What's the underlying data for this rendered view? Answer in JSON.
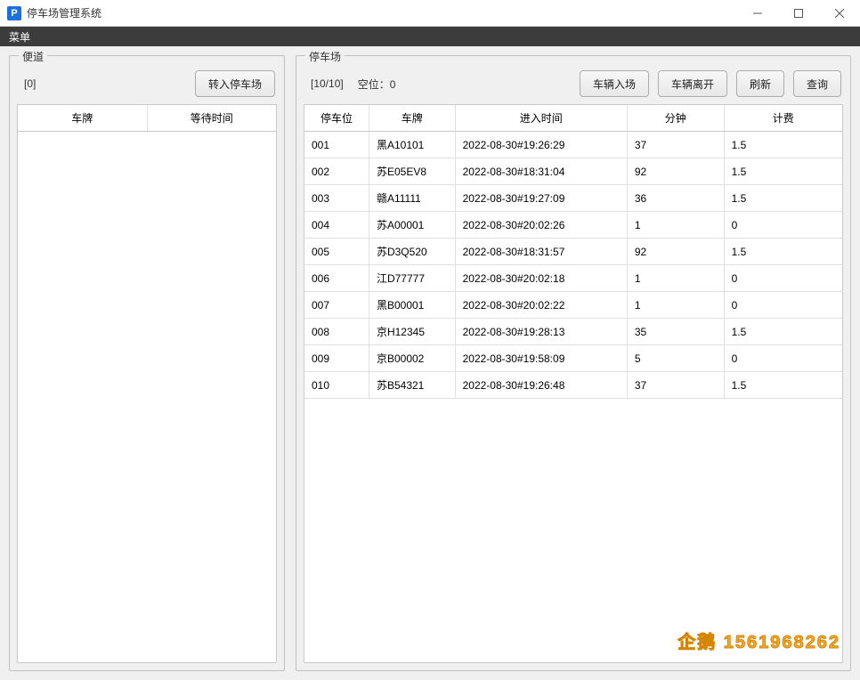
{
  "window": {
    "title": "停车场管理系统"
  },
  "menubar": {
    "menu": "菜单"
  },
  "lane": {
    "group_title": "便道",
    "count_label": "[0]",
    "enter_button": "转入停车场",
    "columns": {
      "plate": "车牌",
      "wait": "等待时间"
    },
    "rows": []
  },
  "lot": {
    "group_title": "停车场",
    "occupancy": "[10/10]",
    "vacancy_label": "空位：0",
    "buttons": {
      "vehicle_in": "车辆入场",
      "vehicle_out": "车辆离开",
      "refresh": "刷新",
      "query": "查询"
    },
    "columns": {
      "slot": "停车位",
      "plate": "车牌",
      "enter_time": "进入时间",
      "minutes": "分钟",
      "fee": "计费"
    },
    "rows": [
      {
        "slot": "001",
        "plate": "黑A10101",
        "enter_time": "2022-08-30#19:26:29",
        "minutes": "37",
        "fee": "1.5"
      },
      {
        "slot": "002",
        "plate": "苏E05EV8",
        "enter_time": "2022-08-30#18:31:04",
        "minutes": "92",
        "fee": "1.5"
      },
      {
        "slot": "003",
        "plate": "赣A11111",
        "enter_time": "2022-08-30#19:27:09",
        "minutes": "36",
        "fee": "1.5"
      },
      {
        "slot": "004",
        "plate": "苏A00001",
        "enter_time": "2022-08-30#20:02:26",
        "minutes": "1",
        "fee": "0"
      },
      {
        "slot": "005",
        "plate": "苏D3Q520",
        "enter_time": "2022-08-30#18:31:57",
        "minutes": "92",
        "fee": "1.5"
      },
      {
        "slot": "006",
        "plate": "江D77777",
        "enter_time": "2022-08-30#20:02:18",
        "minutes": "1",
        "fee": "0"
      },
      {
        "slot": "007",
        "plate": "黑B00001",
        "enter_time": "2022-08-30#20:02:22",
        "minutes": "1",
        "fee": "0"
      },
      {
        "slot": "008",
        "plate": "京H12345",
        "enter_time": "2022-08-30#19:28:13",
        "minutes": "35",
        "fee": "1.5"
      },
      {
        "slot": "009",
        "plate": "京B00002",
        "enter_time": "2022-08-30#19:58:09",
        "minutes": "5",
        "fee": "0"
      },
      {
        "slot": "010",
        "plate": "苏B54321",
        "enter_time": "2022-08-30#19:26:48",
        "minutes": "37",
        "fee": "1.5"
      }
    ]
  },
  "watermark": "企鹅 1561968262"
}
